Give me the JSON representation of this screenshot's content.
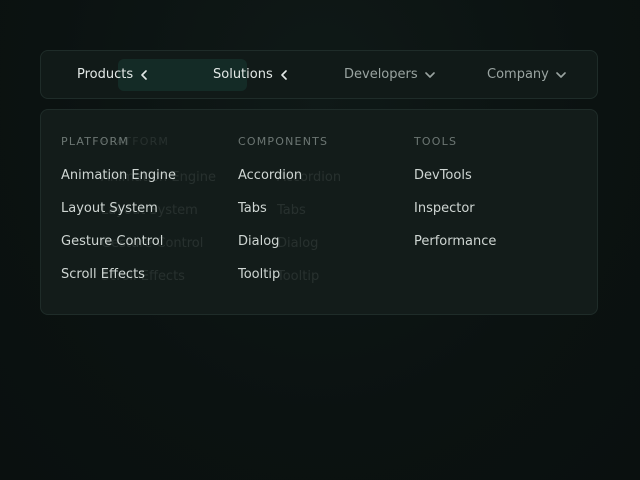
{
  "nav": {
    "items": [
      {
        "label": "Products",
        "chevron": "chevron-left-icon"
      },
      {
        "label": "Solutions",
        "chevron": "chevron-left-icon"
      },
      {
        "label": "Developers",
        "chevron": "chevron-down-icon"
      },
      {
        "label": "Company",
        "chevron": "chevron-down-icon"
      }
    ],
    "highlight_color": "#15302b"
  },
  "dropdown": {
    "columns": [
      {
        "title": "PLATFORM",
        "links": [
          "Animation Engine",
          "Layout System",
          "Gesture Control",
          "Scroll Effects"
        ]
      },
      {
        "title": "COMPONENTS",
        "links": [
          "Accordion",
          "Tabs",
          "Dialog",
          "Tooltip"
        ]
      },
      {
        "title": "TOOLS",
        "links": [
          "DevTools",
          "Inspector",
          "Performance"
        ]
      }
    ]
  },
  "colors": {
    "background": "#0b1211",
    "panel": "#131c1a",
    "border": "#1f2c29",
    "text_active": "#e3e9e7",
    "text_muted": "#9aa4a1",
    "section_title": "#6c7673"
  }
}
